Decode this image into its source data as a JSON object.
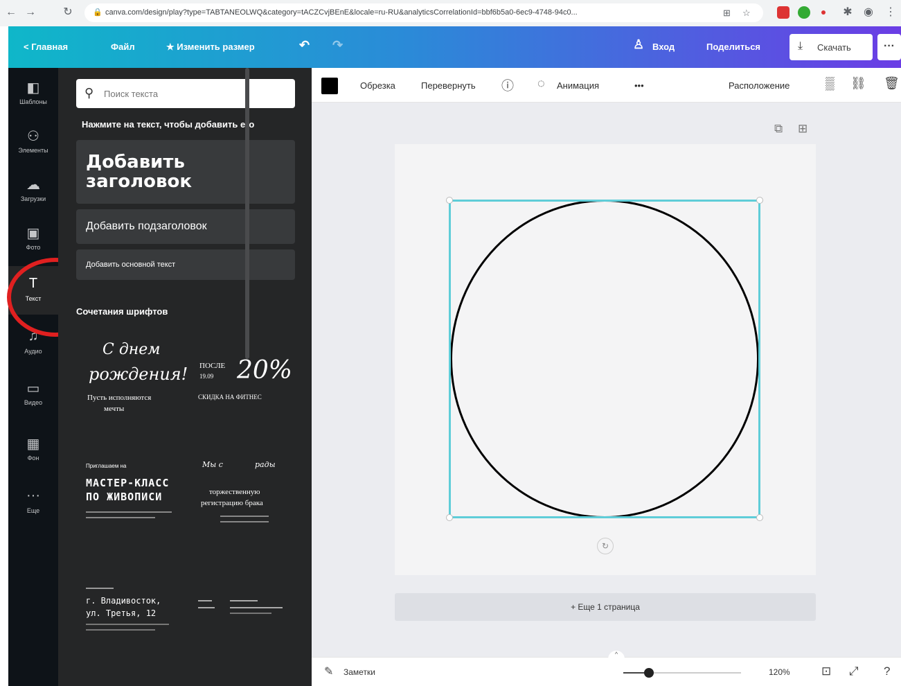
{
  "browser": {
    "back": "←",
    "forward": "→",
    "reload": "↻",
    "url": "canva.com/design/play?type=TABTANEOLWQ&category=tACZCvjBEnE&locale=ru-RU&analyticsCorrelationId=bbf6b5a0-6ec9-4748-94c0...",
    "lock": "🔒"
  },
  "header": {
    "home": "< Главная",
    "file": "Файл",
    "resize": "★ Изменить размер",
    "undo": "↶",
    "redo": "↷",
    "signin": "Вход",
    "share": "Поделиться",
    "download": "Скачать",
    "more": "···"
  },
  "rail": [
    {
      "icon": "templates-icon",
      "glyph": "◧",
      "label": "Шаблоны"
    },
    {
      "icon": "elements-icon",
      "glyph": "⚇",
      "label": "Элементы"
    },
    {
      "icon": "uploads-icon",
      "glyph": "☁",
      "label": "Загрузки"
    },
    {
      "icon": "photos-icon",
      "glyph": "▣",
      "label": "Фото"
    },
    {
      "icon": "text-icon",
      "glyph": "T",
      "label": "Текст"
    },
    {
      "icon": "audio-icon",
      "glyph": "♫",
      "label": "Аудио"
    },
    {
      "icon": "video-icon",
      "glyph": "▭",
      "label": "Видео"
    },
    {
      "icon": "backgrounds-icon",
      "glyph": "▦",
      "label": "Фон"
    },
    {
      "icon": "more-icon",
      "glyph": "···",
      "label": "Еще"
    }
  ],
  "panel": {
    "search_placeholder": "Поиск текста",
    "hint": "Нажмите на текст, чтобы добавить его",
    "add_heading": "Добавить заголовок",
    "add_subheading": "Добавить подзаголовок",
    "add_body": "Добавить основной текст",
    "combos_title": "Сочетания шрифтов",
    "combos": {
      "c1_line1": "С днем",
      "c1_line2": "рождения!",
      "c1_line3": "Пусть исполняются",
      "c1_line4": "мечты",
      "c2_line1": "ПОСЛЕ",
      "c2_line2": "19.09",
      "c2_big": "20%",
      "c2_line3": "СКИДКА НА ФИТНЕС",
      "c3_line1": "Приглашаем на",
      "c3_line2": "МАСТЕР-КЛАСС",
      "c3_line3": "ПО ЖИВОПИСИ",
      "c4_line1": "Мы с",
      "c4_line2": "рады",
      "c4_line3": "торжественную",
      "c4_line4": "регистрацию брака",
      "c5_line1": "г. Владивосток,",
      "c5_line2": "ул. Третья, 12"
    }
  },
  "toolbar": {
    "crop": "Обрезка",
    "flip": "Перевернуть",
    "animation": "Анимация",
    "more": "•••",
    "position": "Расположение"
  },
  "canvas": {
    "add_page": "+ Еще 1 страница"
  },
  "bottom": {
    "notes": "Заметки",
    "zoom": "120%",
    "zoom_fraction": 0.22
  }
}
